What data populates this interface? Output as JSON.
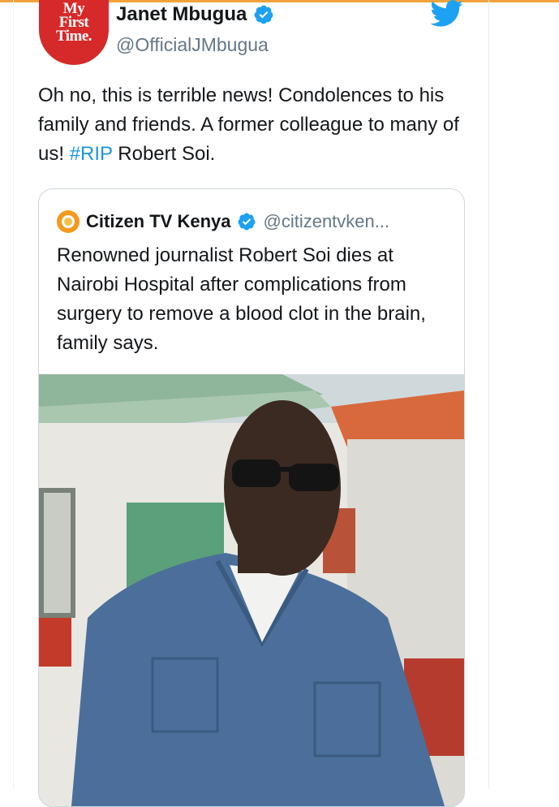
{
  "tweet": {
    "author": {
      "name": "Janet Mbugua",
      "handle": "@OfficialJMbugua",
      "verified": true,
      "avatar_icon": "avatar-my-first-time",
      "avatar_text": "My\nFirst\nTime."
    },
    "text_before_hashtag": "Oh no, this is terrible news! Condolences to his family and friends. A former colleague to many of us! ",
    "hashtag": "#RIP",
    "text_after_hashtag": " Robert Soi.",
    "platform_icon": "twitter-bird-icon"
  },
  "quoted_tweet": {
    "author": {
      "name": "Citizen TV Kenya",
      "handle": "@citizentvken...",
      "verified": true,
      "logo_icon": "citizen-tv-logo-icon"
    },
    "text": "Renowned journalist Robert Soi dies at Nairobi Hospital after complications from surgery to remove a blood clot in the brain, family says.",
    "photo": "photo-of-man-in-denim-shirt-and-sunglasses"
  },
  "colors": {
    "twitter_blue": "#1da1f2",
    "hashtag_blue": "#1b95e0",
    "text_primary": "#14171a",
    "text_secondary": "#657786",
    "avatar_red": "#d62a2a",
    "citizen_orange": "#f39a1e",
    "card_border": "#ccd6dd"
  }
}
